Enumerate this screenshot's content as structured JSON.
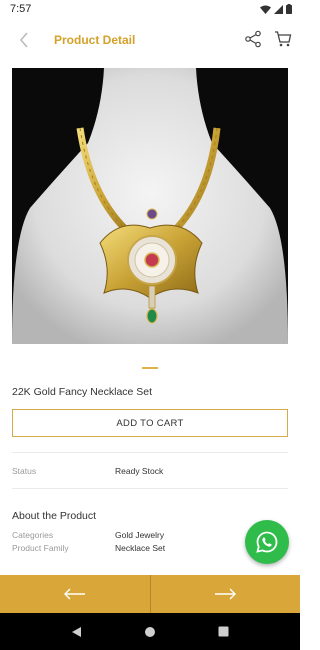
{
  "status_bar": {
    "time": "7:57"
  },
  "header": {
    "title": "Product Detail",
    "back_icon": "chevron-left-icon",
    "share_icon": "share-icon",
    "cart_icon": "cart-icon"
  },
  "product": {
    "name": "22K Gold Fancy Necklace Set",
    "add_to_cart_label": "ADD TO CART",
    "status_label": "Status",
    "status_value": "Ready Stock"
  },
  "about": {
    "title": "About the Product",
    "rows": [
      {
        "label": "Categories",
        "value": "Gold Jewelry"
      },
      {
        "label": "Product Family",
        "value": "Necklace Set"
      }
    ]
  },
  "colors": {
    "accent": "#d4a12a",
    "bottom_bar": "#d9a63a",
    "whatsapp": "#2fbc4a"
  },
  "bottom_nav": {
    "prev_icon": "arrow-left-icon",
    "next_icon": "arrow-right-icon"
  }
}
